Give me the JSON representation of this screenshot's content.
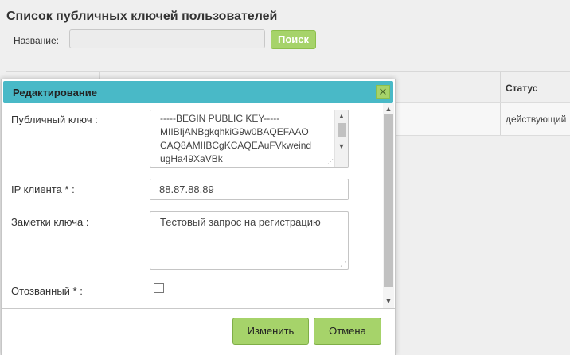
{
  "page": {
    "title": "Список публичных ключей пользователей"
  },
  "search": {
    "label": "Название:",
    "value": "",
    "placeholder": "",
    "button_label": "Поиск"
  },
  "table": {
    "headers": {
      "status": "Статус"
    },
    "rows": [
      {
        "status": "действующий"
      }
    ]
  },
  "dialog": {
    "title": "Редактирование",
    "close_icon": "close-icon",
    "fields": {
      "public_key": {
        "label": "Публичный ключ :",
        "lines": [
          "-----BEGIN PUBLIC KEY-----",
          "MIIBIjANBgkqhkiG9w0BAQEFAAO",
          "CAQ8AMIIBCgKCAQEAuFVkweind",
          "ugHa49XaVBk"
        ]
      },
      "client_ip": {
        "label": "IP клиента * :",
        "value": "88.87.88.89"
      },
      "key_notes": {
        "label": "Заметки ключа :",
        "value": "Тестовый запрос на регистрацию"
      },
      "revoked": {
        "label": "Отозванный * :",
        "checked": false
      }
    },
    "buttons": {
      "save_label": "Изменить",
      "cancel_label": "Отмена"
    }
  },
  "colors": {
    "accent_titlebar": "#49b9c7",
    "button_green": "#a6d36a"
  }
}
